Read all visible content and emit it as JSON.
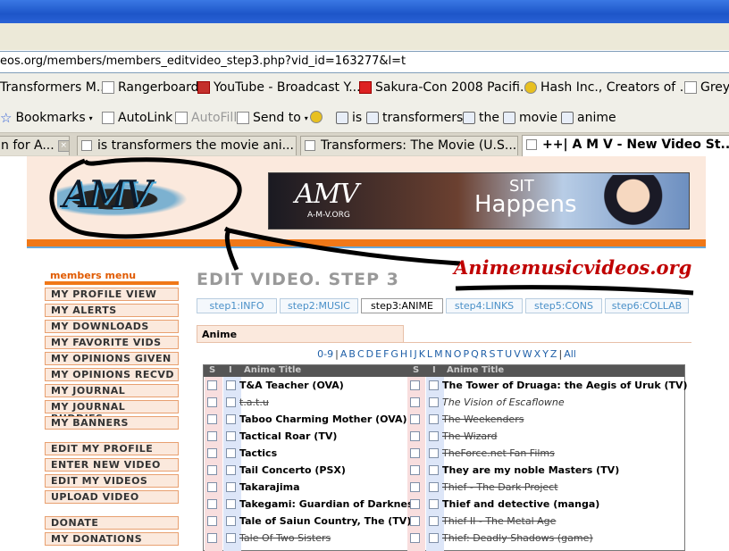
{
  "browser": {
    "url": "eos.org/members/members_editvideo_step3.php?vid_id=163277&l=t",
    "bookmarks_row1": [
      {
        "label": "Transformers M...",
        "icon": "page-icon"
      },
      {
        "label": "Rangerboard",
        "icon": "page-icon"
      },
      {
        "label": "YouTube - Broadcast Y...",
        "icon": "youtube-icon"
      },
      {
        "label": "Sakura-Con 2008 Pacifi...",
        "icon": "wf-icon"
      },
      {
        "label": "Hash Inc., Creators of ...",
        "icon": "hash-icon"
      },
      {
        "label": "Grey",
        "icon": "page-icon"
      }
    ],
    "toolbar_row2": {
      "bookmarks": "Bookmarks",
      "autolink": "AutoLink",
      "autofill": "AutoFill",
      "send_to": "Send to",
      "search_terms": [
        "is",
        "transformers",
        "the",
        "movie",
        "anime"
      ]
    },
    "tabs": [
      {
        "label": "n for A..."
      },
      {
        "label": "is transformers the movie ani..."
      },
      {
        "label": "Transformers: The Movie (U.S..."
      },
      {
        "label": "++| A M V - New Video St..."
      }
    ]
  },
  "header": {
    "logo_text": "AMV",
    "banner": {
      "logo": "AMV",
      "url": "A-M-V.ORG",
      "line1": "SIT",
      "line2": "Happens"
    }
  },
  "annotation": {
    "text": "Animemusicvideos.org"
  },
  "menu": {
    "heading": "members menu",
    "group1": [
      "MY PROFILE VIEW",
      "MY ALERTS",
      "MY DOWNLOADS",
      "MY FAVORITE VIDS",
      "MY OPINIONS GIVEN",
      "MY OPINIONS RECVD",
      "MY JOURNAL",
      "MY JOURNAL BUDDIES",
      "MY BANNERS"
    ],
    "group2": [
      "EDIT MY PROFILE",
      "ENTER NEW VIDEO",
      "EDIT MY VIDEOS",
      "UPLOAD VIDEO"
    ],
    "group3": [
      "DONATE",
      "MY DONATIONS"
    ]
  },
  "main": {
    "title": "EDIT VIDEO. STEP 3",
    "steps": [
      "step1:INFO",
      "step2:MUSIC",
      "step3:ANIME",
      "step4:LINKS",
      "step5:CONS",
      "step6:COLLAB"
    ],
    "current_step": 2,
    "section": "Anime",
    "alpha": [
      "0-9",
      "A",
      "B",
      "C",
      "D",
      "E",
      "F",
      "G",
      "H",
      "I",
      "J",
      "K",
      "L",
      "M",
      "N",
      "O",
      "P",
      "Q",
      "R",
      "S",
      "T",
      "U",
      "V",
      "W",
      "X",
      "Y",
      "Z",
      "All"
    ],
    "table_headers": {
      "s": "S",
      "i": "I",
      "title": "Anime Title"
    },
    "left_titles": [
      {
        "text": "T&A Teacher (OVA)",
        "style": "bold"
      },
      {
        "text": "t.a.t.u",
        "style": "strike"
      },
      {
        "text": "Taboo Charming Mother (OVA)",
        "style": "bold"
      },
      {
        "text": "Tactical Roar (TV)",
        "style": "bold"
      },
      {
        "text": "Tactics",
        "style": "bold"
      },
      {
        "text": "Tail Concerto (PSX)",
        "style": "bold"
      },
      {
        "text": "Takarajima",
        "style": "bold"
      },
      {
        "text": "Takegami: Guardian of Darkness",
        "style": "bold"
      },
      {
        "text": "Tale of Saiun Country, The (TV)",
        "style": "bold"
      },
      {
        "text": "Tale Of Two Sisters",
        "style": "strike"
      }
    ],
    "right_titles": [
      {
        "text": "The Tower of Druaga: the Aegis of Uruk (TV)",
        "style": "bold"
      },
      {
        "text": "The Vision of Escaflowne",
        "style": "ital"
      },
      {
        "text": "The Weekenders",
        "style": "strike"
      },
      {
        "text": "The Wizard",
        "style": "strike"
      },
      {
        "text": "TheForce.net Fan Films",
        "style": "strike"
      },
      {
        "text": "They are my noble Masters (TV)",
        "style": "bold"
      },
      {
        "text": "Thief - The Dark Project",
        "style": "strike"
      },
      {
        "text": "Thief and detective (manga)",
        "style": "bold"
      },
      {
        "text": "Thief II - The Metal Age",
        "style": "strike"
      },
      {
        "text": "Thief: Deadly Shadows (game)",
        "style": "strike"
      }
    ]
  },
  "colors": {
    "accent": "#f07818",
    "link": "#2060a8",
    "header_bg": "#fbe9dd",
    "annotation": "#c00000"
  }
}
